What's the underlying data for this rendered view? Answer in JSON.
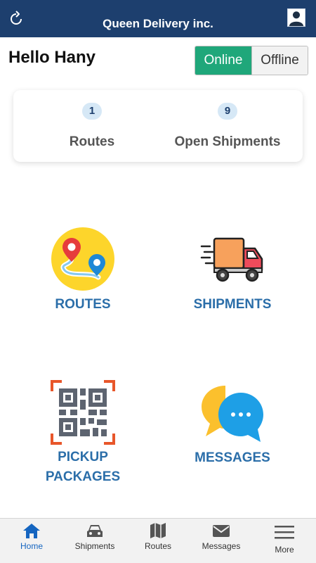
{
  "header": {
    "title": "Queen Delivery inc."
  },
  "greeting": "Hello Hany",
  "status_toggle": {
    "online_label": "Online",
    "offline_label": "Offline",
    "selected": "Online"
  },
  "stats": [
    {
      "count": "1",
      "label": "Routes"
    },
    {
      "count": "9",
      "label": "Open Shipments"
    }
  ],
  "tiles": [
    {
      "label": "ROUTES",
      "icon": "route-map-icon"
    },
    {
      "label": "SHIPMENTS",
      "icon": "delivery-truck-icon"
    },
    {
      "label_line1": "PICKUP",
      "label_line2": "PACKAGES",
      "icon": "qr-code-scan-icon"
    },
    {
      "label": "MESSAGES",
      "icon": "chat-bubbles-icon"
    }
  ],
  "bottom_nav": [
    {
      "label": "Home",
      "icon": "home-icon",
      "active": true
    },
    {
      "label": "Shipments",
      "icon": "car-icon"
    },
    {
      "label": "Routes",
      "icon": "map-icon"
    },
    {
      "label": "Messages",
      "icon": "envelope-icon"
    },
    {
      "label": "More",
      "icon": "menu-icon"
    }
  ],
  "colors": {
    "header_bg": "#1d3f6e",
    "online_green": "#1fa77a",
    "tile_label_blue": "#2b6ea9",
    "nav_active_blue": "#1565c0"
  }
}
